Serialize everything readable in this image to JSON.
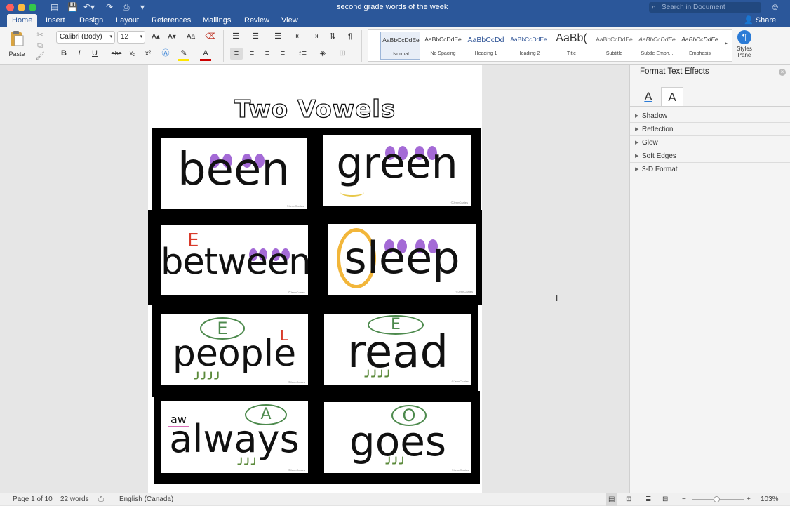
{
  "titlebar": {
    "doc_title": "second grade words of the week",
    "search_placeholder": "Search in Document",
    "share": "Share"
  },
  "tabs": [
    "Home",
    "Insert",
    "Design",
    "Layout",
    "References",
    "Mailings",
    "Review",
    "View"
  ],
  "ribbon": {
    "paste": "Paste",
    "font_name": "Calibri (Body)",
    "font_size": "12",
    "bold": "B",
    "italic": "I",
    "underline": "U",
    "strike": "abc",
    "subscript": "x₂",
    "superscript": "x²",
    "grow": "A▴",
    "shrink": "A▾",
    "case": "Aa",
    "styles": [
      {
        "preview": "AaBbCcDdEe",
        "name": "Normal"
      },
      {
        "preview": "AaBbCcDdEe",
        "name": "No Spacing"
      },
      {
        "preview": "AaBbCcDd",
        "name": "Heading 1"
      },
      {
        "preview": "AaBbCcDdEe",
        "name": "Heading 2"
      },
      {
        "preview": "AaBb(",
        "name": "Title"
      },
      {
        "preview": "AaBbCcDdEe",
        "name": "Subtitle"
      },
      {
        "preview": "AaBbCcDdEe",
        "name": "Subtle Emph..."
      },
      {
        "preview": "AaBbCcDdEe",
        "name": "Emphasis"
      }
    ],
    "styles_pane": "Styles Pane"
  },
  "document": {
    "title": "Two Vowels",
    "cards": [
      {
        "word": "been"
      },
      {
        "word": "green"
      },
      {
        "word": "between",
        "marker": "E"
      },
      {
        "word": "sleep"
      },
      {
        "word": "people",
        "bubble": "E",
        "marker": "L"
      },
      {
        "word": "read",
        "bubble": "E"
      },
      {
        "word": "always",
        "bubble": "A",
        "tag": "aw"
      },
      {
        "word": "goes",
        "bubble": "O"
      }
    ],
    "copyright": "©JennCoates"
  },
  "pane": {
    "title": "Format Text Effects",
    "sections": [
      "Shadow",
      "Reflection",
      "Glow",
      "Soft Edges",
      "3-D Format"
    ]
  },
  "status": {
    "page": "Page 1 of 10",
    "words": "22 words",
    "language": "English (Canada)",
    "zoom": "103%"
  }
}
